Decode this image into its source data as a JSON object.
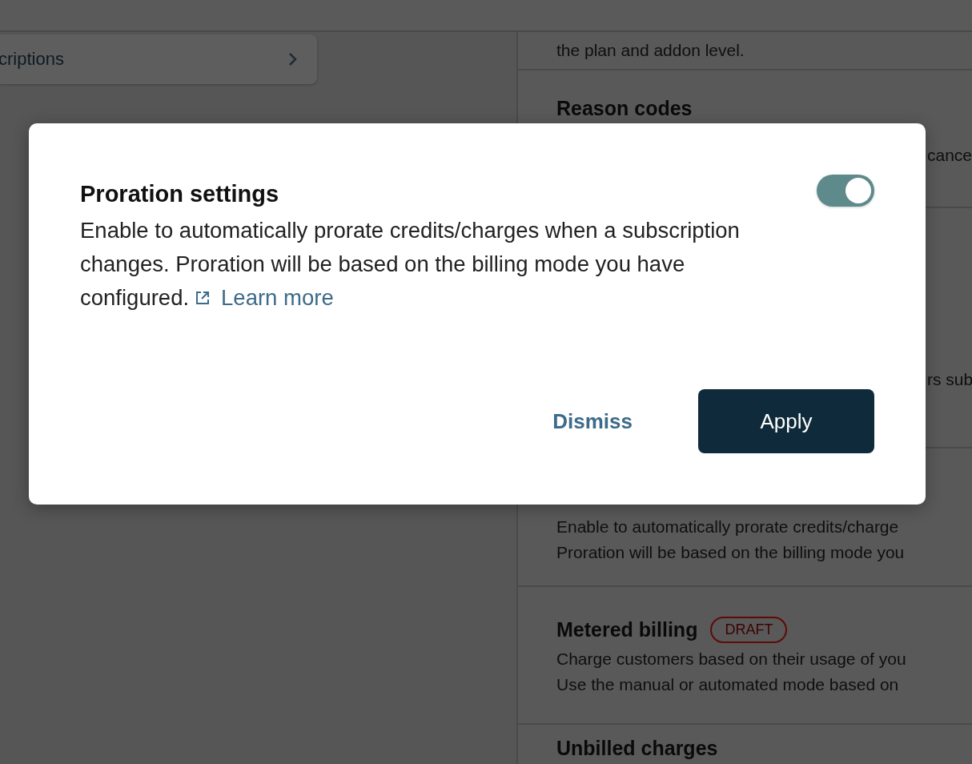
{
  "background": {
    "sidebar_item": {
      "label": "criptions"
    },
    "sections": [
      {
        "kind": "text",
        "lines": [
          "the plan and addon level."
        ]
      },
      {
        "kind": "titled",
        "title": "Reason codes"
      },
      {
        "kind": "covered",
        "lines": [
          "cance"
        ]
      },
      {
        "kind": "blank"
      },
      {
        "kind": "covered",
        "lines": [
          "rs sub"
        ]
      },
      {
        "kind": "text",
        "lines": [
          "Enable to automatically prorate credits/charge",
          "Proration will be based on the billing mode you"
        ]
      },
      {
        "kind": "titled",
        "title": "Metered billing",
        "badge": "DRAFT",
        "lines": [
          "Charge customers based on their usage of you",
          "Use the manual or automated mode based on"
        ]
      },
      {
        "kind": "titled",
        "title": "Unbilled charges"
      }
    ]
  },
  "dialog": {
    "title": "Proration settings",
    "toggle": {
      "on": true
    },
    "description_lines": [
      "Enable to automatically prorate credits/charges when a subscription",
      "changes. Proration will be based on the billing mode you have",
      "configured."
    ],
    "link": "Learn more",
    "buttons": [
      {
        "kind": "secondary",
        "label": "Dismiss"
      },
      {
        "kind": "primary",
        "label": "Apply"
      }
    ]
  }
}
